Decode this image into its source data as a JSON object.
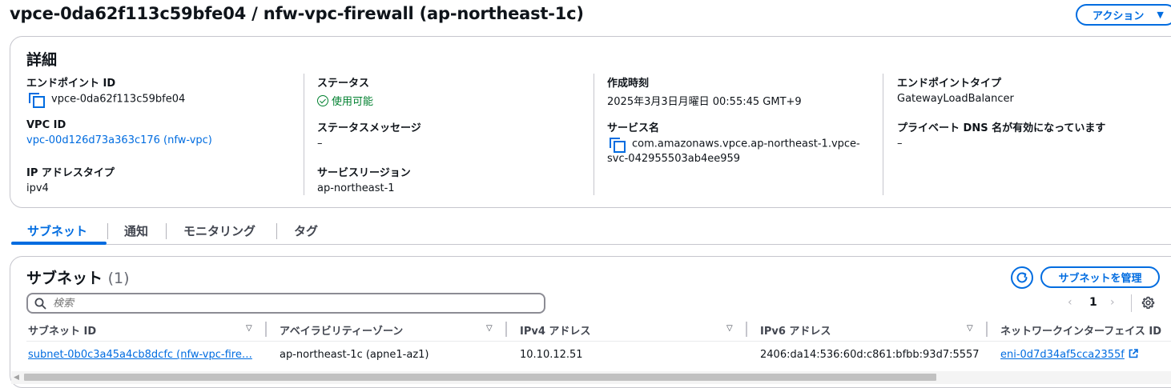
{
  "header": {
    "title": "vpce-0da62f113c59bfe04 / nfw-vpc-firewall (ap-northeast-1c)",
    "action_label": "アクション"
  },
  "details": {
    "heading": "詳細",
    "endpoint_id_label": "エンドポイント ID",
    "endpoint_id_value": "vpce-0da62f113c59bfe04",
    "vpc_id_label": "VPC ID",
    "vpc_id_value": "vpc-00d126d73a363c176 (nfw-vpc)",
    "ip_type_label": "IP アドレスタイプ",
    "ip_type_value": "ipv4",
    "status_label": "ステータス",
    "status_value": "使用可能",
    "status_msg_label": "ステータスメッセージ",
    "status_msg_value": "–",
    "service_region_label": "サービスリージョン",
    "service_region_value": "ap-northeast-1",
    "created_label": "作成時刻",
    "created_value": "2025年3月3日月曜日 00:55:45 GMT+9",
    "service_name_label": "サービス名",
    "service_name_line1": "com.amazonaws.vpce.ap-northeast-1.vpce-",
    "service_name_line2": "svc-042955503ab4ee959",
    "endpoint_type_label": "エンドポイントタイプ",
    "endpoint_type_value": "GatewayLoadBalancer",
    "private_dns_label": "プライベート DNS 名が有効になっています",
    "private_dns_value": "–"
  },
  "tabs": [
    {
      "label": "サブネット"
    },
    {
      "label": "通知"
    },
    {
      "label": "モニタリング"
    },
    {
      "label": "タグ"
    }
  ],
  "subnets": {
    "heading": "サブネット",
    "count": "(1)",
    "manage_label": "サブネットを管理",
    "search_placeholder": "検索",
    "page": "1",
    "columns": [
      "サブネット ID",
      "アベイラビリティーゾーン",
      "IPv4 アドレス",
      "IPv6 アドレス",
      "ネットワークインターフェイス ID"
    ],
    "rows": [
      {
        "subnet_id": "subnet-0b0c3a45a4cb8dcfc (nfw-vpc-fire…",
        "az": "ap-northeast-1c (apne1-az1)",
        "ipv4": "10.10.12.51",
        "ipv6": "2406:da14:536:60d:c861:bfbb:93d7:5557",
        "eni": "eni-0d7d34af5cca2355f"
      }
    ]
  },
  "colors": {
    "accent": "#006ce0",
    "success": "#00802f",
    "text": "#0f141a"
  }
}
